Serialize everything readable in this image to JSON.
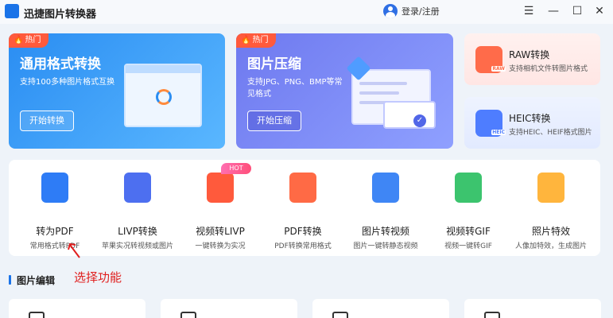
{
  "window": {
    "title": "迅捷图片转换器",
    "login_label": "登录/注册",
    "menu_glyph": "☰",
    "minimize_glyph": "—",
    "maximize_glyph": "☐",
    "close_glyph": "✕"
  },
  "featured": [
    {
      "tag": "热门",
      "title": "通用格式转换",
      "desc": "支持100多种图片格式互换",
      "button": "开始转换"
    },
    {
      "tag": "热门",
      "title": "图片压缩",
      "desc": "支持JPG、PNG、BMP等常见格式",
      "button": "开始压缩"
    }
  ],
  "side_cards": [
    {
      "title": "RAW转换",
      "desc": "支持相机文件转图片格式",
      "icon_label": "RAW"
    },
    {
      "title": "HEIC转换",
      "desc": "支持HEIC、HEIF格式图片",
      "icon_label": "HEIC"
    }
  ],
  "tools": [
    {
      "name": "转为PDF",
      "desc": "常用格式转PDF",
      "color": "#2e7cf6"
    },
    {
      "name": "LIVP转换",
      "desc": "苹果实况转视频或图片",
      "color": "#4d6ff0"
    },
    {
      "name": "视频转LIVP",
      "desc": "一键转换为实况",
      "color": "#ff5a3c"
    },
    {
      "name": "PDF转换",
      "desc": "PDF转换常用格式",
      "color": "#ff6a45"
    },
    {
      "name": "图片转视频",
      "desc": "图片一键转静态视频",
      "color": "#3f86f5"
    },
    {
      "name": "视频转GIF",
      "desc": "视频一键转GIF",
      "color": "#3cc46e"
    },
    {
      "name": "照片特效",
      "desc": "人像加特效，生成图片",
      "color": "#ffb53d"
    }
  ],
  "hot_badge": "HOT",
  "annotation": "选择功能",
  "section_title": "图片编辑",
  "flame_glyph": "🔥",
  "check_glyph": "✓"
}
